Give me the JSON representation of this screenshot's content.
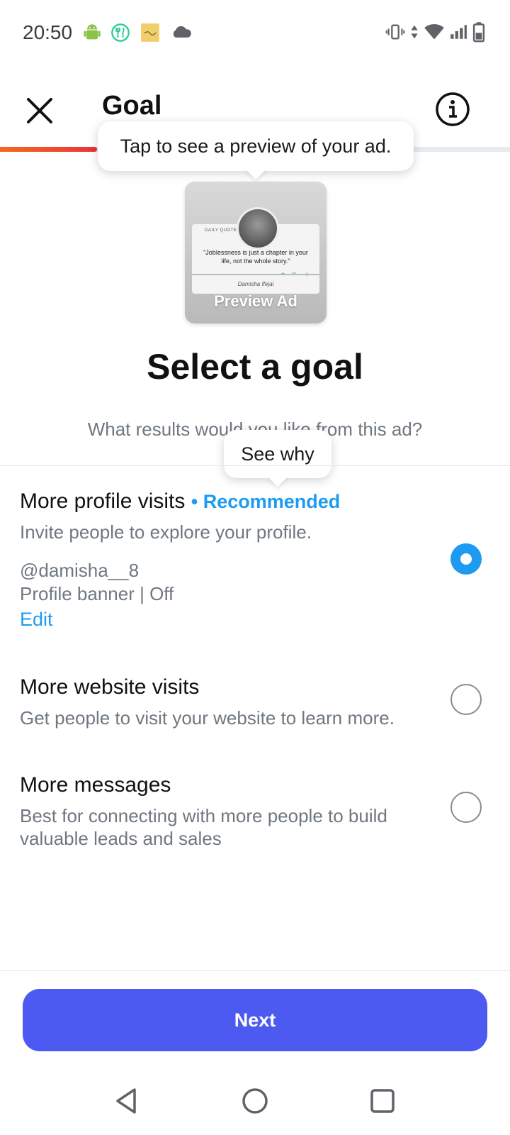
{
  "status_bar": {
    "time": "20:50",
    "left_icons": [
      "android-icon",
      "fork-knife-icon",
      "app-thumbnail-icon",
      "cloud-icon"
    ],
    "right_icons": [
      "vibrate-icon",
      "data-arrows-icon",
      "wifi-icon",
      "cellular-signal-icon",
      "battery-icon"
    ]
  },
  "header": {
    "title": "Goal",
    "close_icon": "close-icon",
    "info_icon": "info-icon"
  },
  "progress": {
    "fraction": 0.19,
    "fill_color": "#e8343a"
  },
  "tooltips": {
    "preview_hint": "Tap to see a preview of your ad.",
    "see_why": "See why"
  },
  "preview": {
    "label": "Preview Ad",
    "brand": "DAILY QUOTE",
    "quote": "\"Joblessness is just a chapter in your life, not the whole story.\"",
    "signature": "Damisha Ifejai"
  },
  "main": {
    "title": "Select a goal",
    "subtitle": "What results would you like from this ad?"
  },
  "options": [
    {
      "title": "More profile visits",
      "badge": "• Recommended",
      "description": "Invite people to explore your profile.",
      "handle": "@damisha__8",
      "banner_status": "Profile banner | Off",
      "edit_label": "Edit",
      "selected": true
    },
    {
      "title": "More website visits",
      "description": "Get people to visit your website to learn more.",
      "selected": false
    },
    {
      "title": "More messages",
      "description": "Best for connecting with more people to build valuable leads and sales",
      "selected": false
    }
  ],
  "footer": {
    "next_label": "Next"
  },
  "colors": {
    "accent": "#1d9bf0",
    "button": "#4d5af2",
    "progress_start": "#f26b1d"
  }
}
